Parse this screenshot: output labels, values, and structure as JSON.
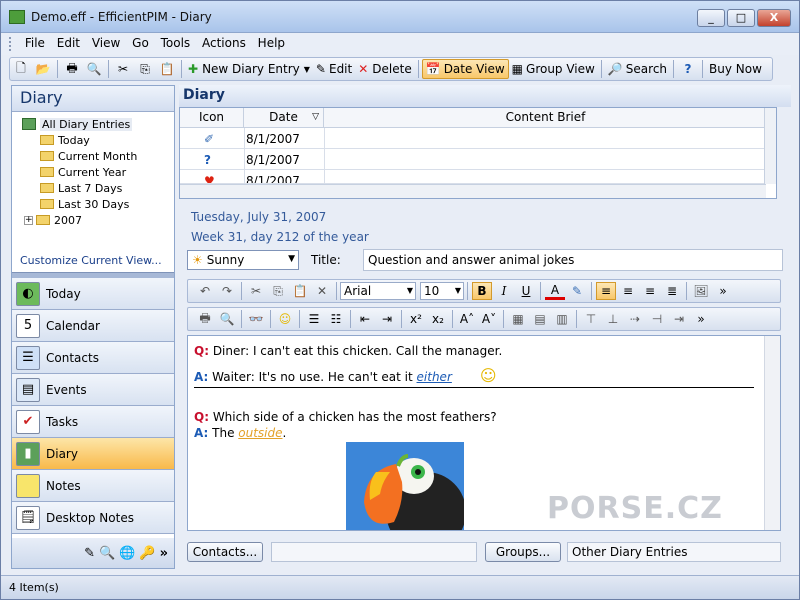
{
  "window": {
    "title": "Demo.eff - EfficientPIM - Diary",
    "btn_min": "_",
    "btn_max": "□",
    "btn_close": "X"
  },
  "menu": [
    "File",
    "Edit",
    "View",
    "Go",
    "Tools",
    "Actions",
    "Help"
  ],
  "toolbar": {
    "new_entry": "New Diary Entry",
    "edit": "Edit",
    "delete": "Delete",
    "date_view": "Date View",
    "group_view": "Group View",
    "search": "Search",
    "buy_now": "Buy Now"
  },
  "sidebar": {
    "title": "Diary",
    "tree": {
      "root": "All Diary Entries",
      "items": [
        "Today",
        "Current Month",
        "Current Year",
        "Last 7 Days",
        "Last 30 Days",
        "2007"
      ]
    },
    "customize": "Customize Current View...",
    "nav": [
      "Today",
      "Calendar",
      "Contacts",
      "Events",
      "Tasks",
      "Diary",
      "Notes",
      "Desktop Notes"
    ],
    "selected": "Diary"
  },
  "main": {
    "title": "Diary",
    "grid": {
      "columns": [
        "Icon",
        "Date",
        "Content Brief"
      ],
      "rows": [
        {
          "icon": "note-icon",
          "date": "8/1/2007",
          "brief": ""
        },
        {
          "icon": "question-icon",
          "date": "8/1/2007",
          "brief": ""
        },
        {
          "icon": "heart-icon",
          "date": "8/1/2007",
          "brief": ""
        }
      ]
    },
    "date_line": "Tuesday, July 31, 2007",
    "week_line": "Week 31, day 212 of the year",
    "weather": "Sunny",
    "title_label": "Title:",
    "title_value": "Question and answer animal jokes",
    "font": "Arial",
    "size": "10",
    "editor": {
      "q1_label": "Q:",
      "q1_text": " Diner: I can't eat this chicken. Call the manager.",
      "a1_label": "A:",
      "a1_text": " Waiter: It's no use. He can't eat it ",
      "a1_link": "either",
      "q2_label": "Q:",
      "q2_text": " Which side of a chicken has the most feathers?",
      "a2_label": "A:",
      "a2_text": " The ",
      "a2_link": "outside",
      "a2_tail": "."
    },
    "contacts_btn": "Contacts...",
    "groups_btn": "Groups...",
    "groups_value": "Other Diary Entries"
  },
  "status": "4 Item(s)",
  "watermark": "PORSE.CZ"
}
